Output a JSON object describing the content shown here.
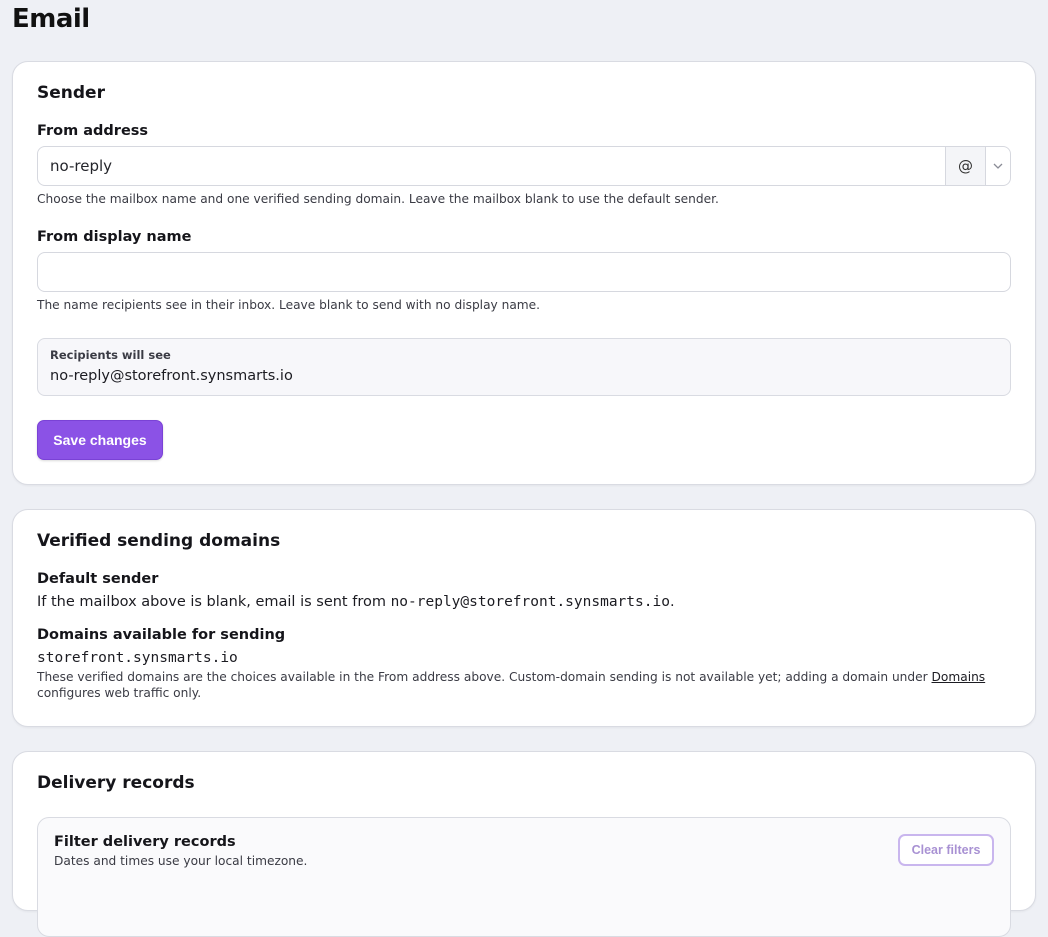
{
  "page": {
    "title": "Email"
  },
  "sender": {
    "title": "Sender",
    "from_address": {
      "label": "From address",
      "value": "no-reply",
      "at_symbol": "@",
      "domain_select_icon": "chevron-down-icon",
      "help": "Choose the mailbox name and one verified sending domain. Leave the mailbox blank to use the default sender."
    },
    "from_display_name": {
      "label": "From display name",
      "value": "",
      "help": "The name recipients see in their inbox. Leave blank to send with no display name."
    },
    "preview": {
      "label": "Recipients will see",
      "value": "no-reply@storefront.synsmarts.io"
    },
    "save_label": "Save changes",
    "accent_color": "#8b52e6"
  },
  "domains": {
    "title": "Verified sending domains",
    "default_sender": {
      "label": "Default sender",
      "text_before": "If the mailbox above is blank, email is sent from ",
      "address": "no-reply@storefront.synsmarts.io",
      "text_after": "."
    },
    "available": {
      "label": "Domains available for sending",
      "domain": "storefront.synsmarts.io",
      "help_before": "These verified domains are the choices available in the From address above. Custom-domain sending is not available yet; adding a domain under ",
      "help_link": "Domains",
      "help_after": " configures web traffic only."
    }
  },
  "delivery": {
    "title": "Delivery records",
    "filter": {
      "title": "Filter delivery records",
      "subtitle": "Dates and times use your local timezone.",
      "clear_label": "Clear filters"
    }
  }
}
